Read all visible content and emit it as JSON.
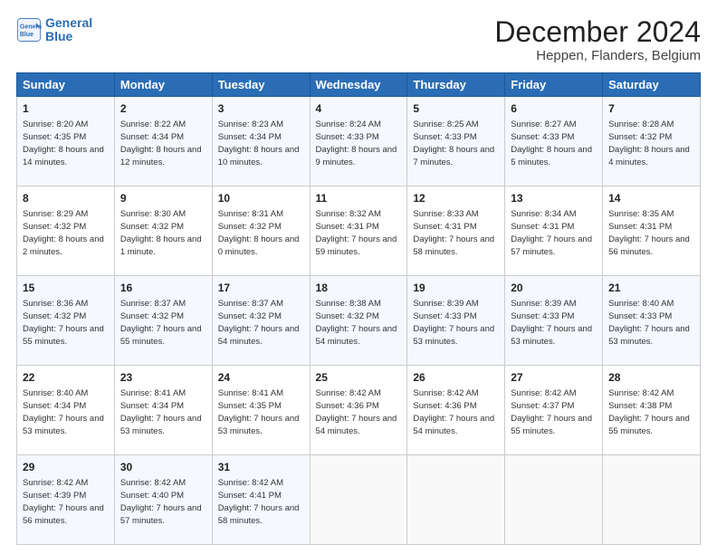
{
  "logo": {
    "line1": "General",
    "line2": "Blue"
  },
  "title": "December 2024",
  "subtitle": "Heppen, Flanders, Belgium",
  "weekdays": [
    "Sunday",
    "Monday",
    "Tuesday",
    "Wednesday",
    "Thursday",
    "Friday",
    "Saturday"
  ],
  "weeks": [
    [
      {
        "day": "1",
        "rise": "8:20 AM",
        "set": "4:35 PM",
        "daylight": "8 hours and 14 minutes."
      },
      {
        "day": "2",
        "rise": "8:22 AM",
        "set": "4:34 PM",
        "daylight": "8 hours and 12 minutes."
      },
      {
        "day": "3",
        "rise": "8:23 AM",
        "set": "4:34 PM",
        "daylight": "8 hours and 10 minutes."
      },
      {
        "day": "4",
        "rise": "8:24 AM",
        "set": "4:33 PM",
        "daylight": "8 hours and 9 minutes."
      },
      {
        "day": "5",
        "rise": "8:25 AM",
        "set": "4:33 PM",
        "daylight": "8 hours and 7 minutes."
      },
      {
        "day": "6",
        "rise": "8:27 AM",
        "set": "4:33 PM",
        "daylight": "8 hours and 5 minutes."
      },
      {
        "day": "7",
        "rise": "8:28 AM",
        "set": "4:32 PM",
        "daylight": "8 hours and 4 minutes."
      }
    ],
    [
      {
        "day": "8",
        "rise": "8:29 AM",
        "set": "4:32 PM",
        "daylight": "8 hours and 2 minutes."
      },
      {
        "day": "9",
        "rise": "8:30 AM",
        "set": "4:32 PM",
        "daylight": "8 hours and 1 minute."
      },
      {
        "day": "10",
        "rise": "8:31 AM",
        "set": "4:32 PM",
        "daylight": "8 hours and 0 minutes."
      },
      {
        "day": "11",
        "rise": "8:32 AM",
        "set": "4:31 PM",
        "daylight": "7 hours and 59 minutes."
      },
      {
        "day": "12",
        "rise": "8:33 AM",
        "set": "4:31 PM",
        "daylight": "7 hours and 58 minutes."
      },
      {
        "day": "13",
        "rise": "8:34 AM",
        "set": "4:31 PM",
        "daylight": "7 hours and 57 minutes."
      },
      {
        "day": "14",
        "rise": "8:35 AM",
        "set": "4:31 PM",
        "daylight": "7 hours and 56 minutes."
      }
    ],
    [
      {
        "day": "15",
        "rise": "8:36 AM",
        "set": "4:32 PM",
        "daylight": "7 hours and 55 minutes."
      },
      {
        "day": "16",
        "rise": "8:37 AM",
        "set": "4:32 PM",
        "daylight": "7 hours and 55 minutes."
      },
      {
        "day": "17",
        "rise": "8:37 AM",
        "set": "4:32 PM",
        "daylight": "7 hours and 54 minutes."
      },
      {
        "day": "18",
        "rise": "8:38 AM",
        "set": "4:32 PM",
        "daylight": "7 hours and 54 minutes."
      },
      {
        "day": "19",
        "rise": "8:39 AM",
        "set": "4:33 PM",
        "daylight": "7 hours and 53 minutes."
      },
      {
        "day": "20",
        "rise": "8:39 AM",
        "set": "4:33 PM",
        "daylight": "7 hours and 53 minutes."
      },
      {
        "day": "21",
        "rise": "8:40 AM",
        "set": "4:33 PM",
        "daylight": "7 hours and 53 minutes."
      }
    ],
    [
      {
        "day": "22",
        "rise": "8:40 AM",
        "set": "4:34 PM",
        "daylight": "7 hours and 53 minutes."
      },
      {
        "day": "23",
        "rise": "8:41 AM",
        "set": "4:34 PM",
        "daylight": "7 hours and 53 minutes."
      },
      {
        "day": "24",
        "rise": "8:41 AM",
        "set": "4:35 PM",
        "daylight": "7 hours and 53 minutes."
      },
      {
        "day": "25",
        "rise": "8:42 AM",
        "set": "4:36 PM",
        "daylight": "7 hours and 54 minutes."
      },
      {
        "day": "26",
        "rise": "8:42 AM",
        "set": "4:36 PM",
        "daylight": "7 hours and 54 minutes."
      },
      {
        "day": "27",
        "rise": "8:42 AM",
        "set": "4:37 PM",
        "daylight": "7 hours and 55 minutes."
      },
      {
        "day": "28",
        "rise": "8:42 AM",
        "set": "4:38 PM",
        "daylight": "7 hours and 55 minutes."
      }
    ],
    [
      {
        "day": "29",
        "rise": "8:42 AM",
        "set": "4:39 PM",
        "daylight": "7 hours and 56 minutes."
      },
      {
        "day": "30",
        "rise": "8:42 AM",
        "set": "4:40 PM",
        "daylight": "7 hours and 57 minutes."
      },
      {
        "day": "31",
        "rise": "8:42 AM",
        "set": "4:41 PM",
        "daylight": "7 hours and 58 minutes."
      },
      null,
      null,
      null,
      null
    ]
  ],
  "labels": {
    "sunrise": "Sunrise:",
    "sunset": "Sunset:",
    "daylight": "Daylight:"
  }
}
